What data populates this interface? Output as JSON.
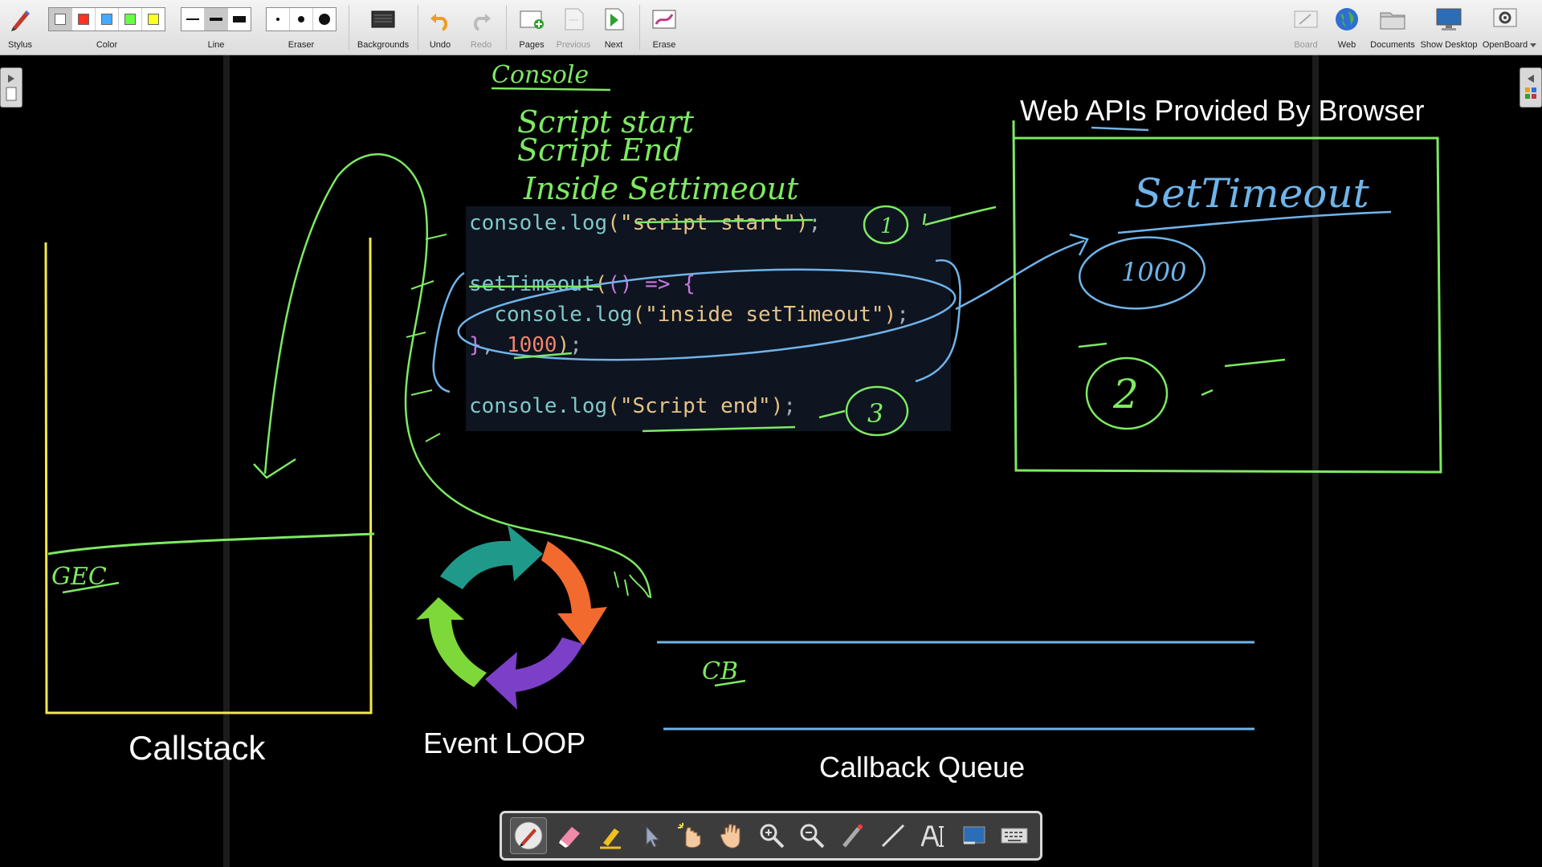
{
  "toolbar": {
    "stylus": "Stylus",
    "color": "Color",
    "colors": [
      "#ffffff",
      "#ff3322",
      "#44aaff",
      "#66ff44",
      "#ffff22"
    ],
    "line": "Line",
    "eraser": "Eraser",
    "backgrounds": "Backgrounds",
    "undo": "Undo",
    "redo": "Redo",
    "pages": "Pages",
    "previous": "Previous",
    "next": "Next",
    "erase": "Erase",
    "board": "Board",
    "web": "Web",
    "documents": "Documents",
    "show_desktop": "Show Desktop",
    "openboard": "OpenBoard"
  },
  "board": {
    "web_apis_title": "Web APIs Provided By Browser",
    "callstack_label": "Callstack",
    "event_loop_label": "Event LOOP",
    "callback_queue_label": "Callback Queue"
  },
  "code": {
    "l1_fn": "console.log",
    "l1_str": "\"script start\"",
    "l2_fn": "setTimeout",
    "l3_fn": "console.log",
    "l3_str": "\"inside setTimeout\"",
    "l4_num": "1000",
    "l5_fn": "console.log",
    "l5_str": "\"Script end\""
  },
  "handwriting": {
    "console": "Console",
    "log1": "Script start",
    "log2": "Script End",
    "log3": "Inside Settimeout",
    "gec": "GEC",
    "settimeout": "SetTimeout",
    "ms": "1000",
    "num1": "1",
    "num2": "2",
    "num3": "3",
    "cb": "CB"
  },
  "colors": {
    "annotation_green": "#7dea62",
    "annotation_blue": "#6fb4ea",
    "callstack_yellow": "#f2ea4a",
    "arrow_teal": "#1f9a8a",
    "arrow_orange": "#f26a2e",
    "arrow_purple": "#7b3fc8",
    "arrow_green": "#7ed83a"
  }
}
